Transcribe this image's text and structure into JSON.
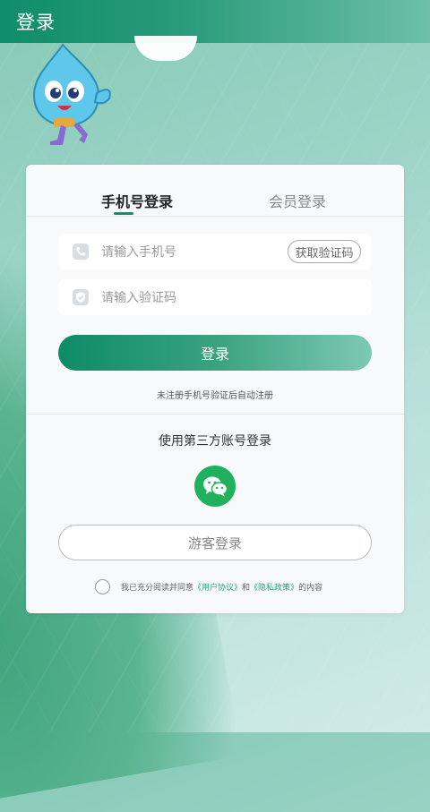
{
  "header": {
    "title": "登录"
  },
  "tabs": [
    {
      "label": "手机号登录",
      "active": true
    },
    {
      "label": "会员登录",
      "active": false
    }
  ],
  "phone": {
    "placeholder": "请输入手机号",
    "icon": "phone-icon"
  },
  "get_code_label": "获取验证码",
  "code": {
    "placeholder": "请输入验证码",
    "icon": "shield-icon"
  },
  "login_label": "登录",
  "hint": "未注册手机号验证后自动注册",
  "third_party": {
    "title": "使用第三方账号登录",
    "icon": "wechat-icon"
  },
  "guest_label": "游客登录",
  "agreement": {
    "prefix": "我已充分阅读并同意",
    "user_agreement": "《用户协议》",
    "and": "和",
    "privacy_policy": "《隐私政策》",
    "suffix": "的内容"
  },
  "colors": {
    "primary": "#148e68",
    "wechat": "#21b05c",
    "link": "#2aa37a"
  }
}
